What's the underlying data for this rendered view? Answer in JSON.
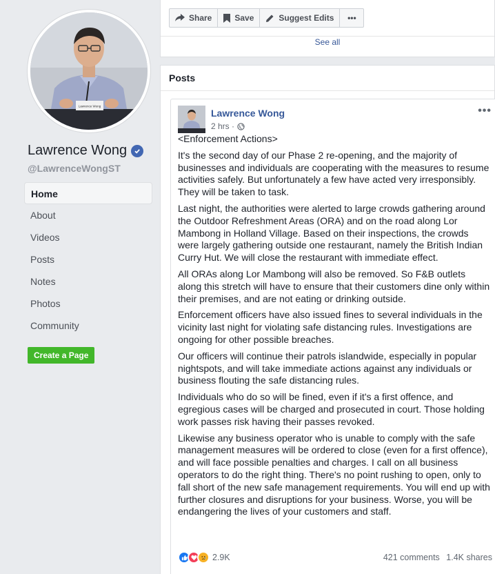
{
  "profile": {
    "name": "Lawrence Wong",
    "handle": "@LawrenceWongST",
    "nameplate": "Lawrence Wong"
  },
  "nav": {
    "items": [
      {
        "label": "Home",
        "active": true
      },
      {
        "label": "About"
      },
      {
        "label": "Videos"
      },
      {
        "label": "Posts"
      },
      {
        "label": "Notes"
      },
      {
        "label": "Photos"
      },
      {
        "label": "Community"
      }
    ],
    "create_page": "Create a Page"
  },
  "actions": {
    "share": "Share",
    "save": "Save",
    "suggest_edits": "Suggest Edits",
    "more": "•••",
    "see_all": "See all"
  },
  "posts": {
    "title": "Posts",
    "post": {
      "author": "Lawrence Wong",
      "time": "2 hrs ·",
      "more": "•••",
      "paragraphs": [
        "<Enforcement Actions>",
        "It's the second day of our Phase 2 re-opening, and the majority of businesses and individuals are cooperating with the measures to resume activities safely. But unfortunately a few have acted very irresponsibly. They will be taken to task.",
        "Last night, the authorities were alerted to large crowds gathering around the Outdoor Refreshment Areas (ORA) and on the road along Lor Mambong in Holland Village. Based on their inspections, the crowds were largely gathering outside one restaurant, namely the British Indian Curry Hut. We will close the restaurant with immediate effect.",
        "All ORAs along Lor Mambong will also be removed. So F&B outlets along this stretch will have to ensure that their customers dine only within their premises, and are not eating or drinking outside.",
        "Enforcement officers have also issued fines to several individuals in the vicinity last night for violating safe distancing rules. Investigations are ongoing for other possible breaches.",
        "Our officers will continue their patrols islandwide, especially in popular nightspots, and will take immediate actions against any individuals or business flouting the safe distancing rules.",
        "Individuals who do so will be fined, even if it's a first offence, and egregious cases will be charged and prosecuted in court. Those holding work passes risk having their passes revoked.",
        "Likewise any business operator who is unable to comply with the safe management measures will be ordered to close (even for a first offence), and will face possible penalties and charges. I call on all business operators to do the right thing. There's no point rushing to open, only to fall short of the new safe management requirements. You will end up with further closures and disruptions for your business. Worse, you will be endangering the lives of your customers and staff."
      ],
      "reactions_count": "2.9K",
      "comments": "421 comments",
      "shares": "1.4K shares"
    }
  },
  "colors": {
    "brand_blue": "#4267b2",
    "link_blue": "#365899",
    "create_green": "#42b72a",
    "page_bg": "#e9ebee"
  }
}
